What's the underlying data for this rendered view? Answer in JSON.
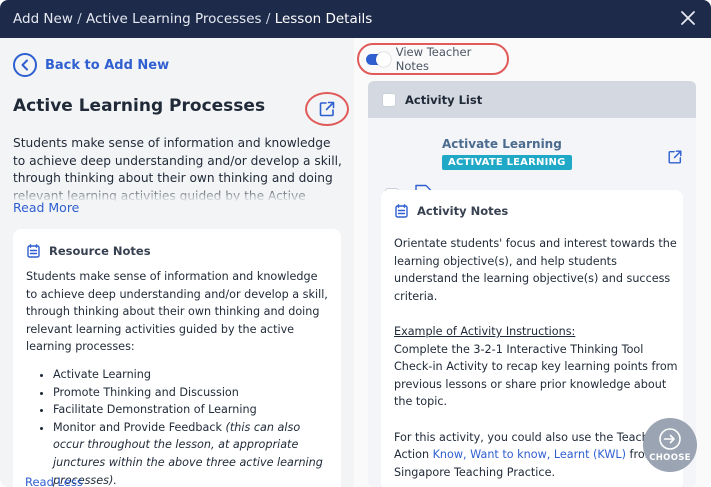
{
  "header": {
    "breadcrumbs": [
      "Add New",
      "Active Learning Processes",
      "Lesson Details"
    ],
    "separator": "/",
    "close_icon": "close-icon"
  },
  "left": {
    "back_label": "Back to Add New",
    "title": "Active Learning Processes",
    "description": "Students make sense of information and knowledge to achieve deep understanding and/or develop a skill, through thinking about their own thinking and doing relevant learning activities guided by the Active Learning Processes.",
    "read_more": "Read More",
    "resource_notes": {
      "heading": "Resource Notes",
      "intro": "Students make sense of information and knowledge to achieve deep understanding and/or develop a skill, through thinking about their own thinking and doing relevant learning activities guided by the active learning processes:",
      "items": [
        {
          "text": "Activate Learning",
          "note": ""
        },
        {
          "text": "Promote Thinking and Discussion",
          "note": ""
        },
        {
          "text": "Facilitate Demonstration of Learning",
          "note": ""
        },
        {
          "text": "Monitor and Provide Feedback ",
          "note": "(this can also occur throughout the lesson, at appropriate junctures within the above three active learning processes)."
        }
      ],
      "read_less": "Read Less"
    }
  },
  "right": {
    "toggle": {
      "label": "View Teacher Notes",
      "on": true
    },
    "activity_list": {
      "heading": "Activity List",
      "item": {
        "step": "1",
        "title": "Activate Learning",
        "badge": "ACTIVATE LEARNING",
        "notes_heading": "Activity Notes",
        "p1": "Orientate students' focus and interest towards the learning objective(s), and help students understand the learning objective(s) and success criteria.",
        "instructions_heading": "Example of Activity Instructions:",
        "instructions": "Complete the 3-2-1 Interactive Thinking Tool Check-in Activity to recap key learning points from previous lessons or share prior knowledge about the topic.",
        "p3_before": "For this activity, you could also use the Teaching Action ",
        "p3_link": "Know, Want to know, Learnt (KWL)",
        "p3_after": " from Singapore Teaching Practice."
      }
    },
    "choose_label": "CHOOSE"
  },
  "colors": {
    "header_bg": "#1e2a4a",
    "accent": "#2f5fd0",
    "badge": "#1fa9c7",
    "highlight_ring": "#e05a5a"
  }
}
